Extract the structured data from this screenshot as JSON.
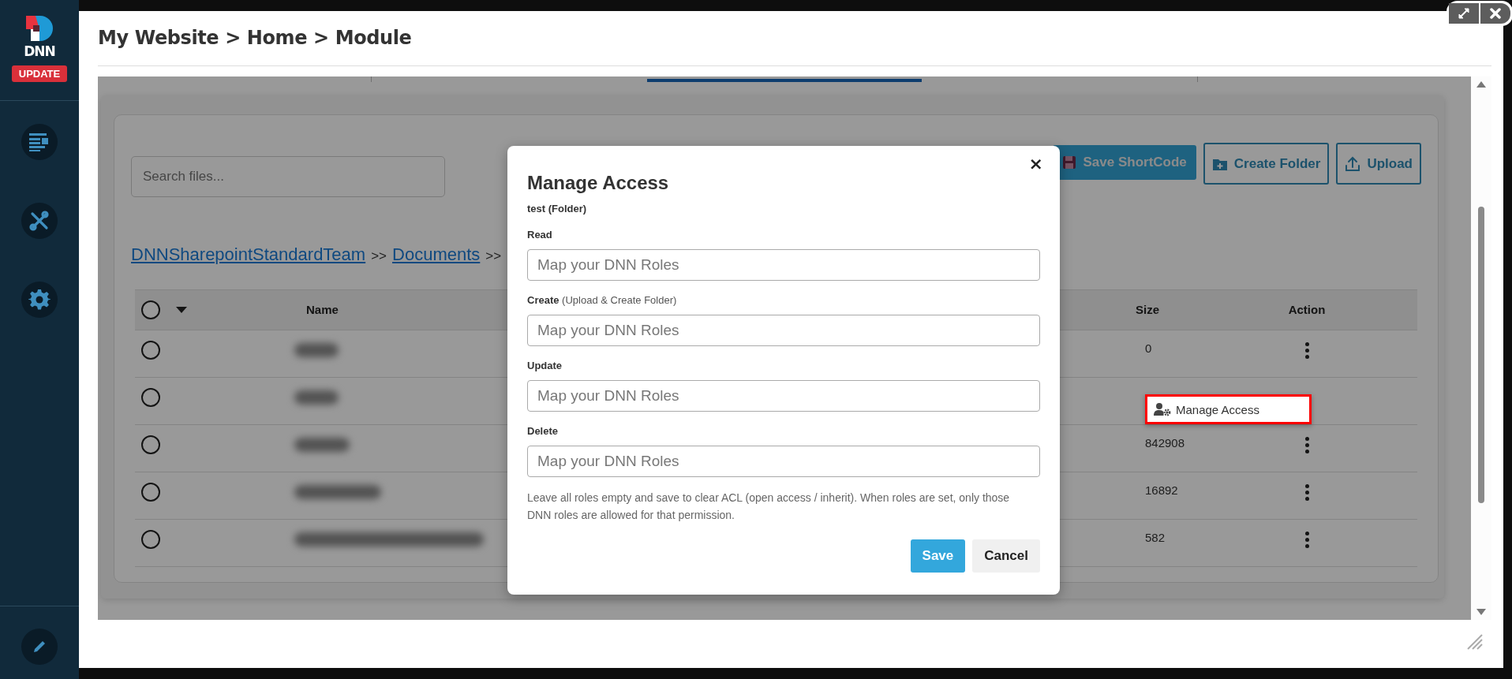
{
  "sidebar": {
    "logo_text": "DNN",
    "update_badge": "UPDATE",
    "nav": [
      {
        "kind": "pages"
      },
      {
        "kind": "tools"
      },
      {
        "kind": "settings"
      }
    ],
    "footer": [
      {
        "kind": "edit"
      }
    ]
  },
  "window": {
    "title": "My Website > Home > Module"
  },
  "window_controls": [
    {
      "kind": "maximize"
    },
    {
      "kind": "close"
    }
  ],
  "module": {
    "search": {
      "placeholder": "Search files..."
    },
    "buttons": [
      {
        "label": "Save ShortCode",
        "kind": "save"
      },
      {
        "label": "Create Folder",
        "kind": "folder"
      },
      {
        "label": "Upload",
        "kind": "upload"
      }
    ],
    "path": [
      {
        "label": "DNNSharepointStandardTeam",
        "kind": "link"
      },
      {
        "label": ">>",
        "kind": "separator"
      },
      {
        "label": "Documents",
        "kind": "link"
      },
      {
        "label": ">>",
        "kind": "separator"
      }
    ],
    "table": {
      "select_all": false,
      "columns": [
        {
          "label": "Name",
          "kind": "name"
        },
        {
          "label": "Size",
          "kind": "size"
        },
        {
          "label": "Action",
          "kind": "action"
        }
      ],
      "rows": [
        {
          "selected": false,
          "name_blurred": true,
          "size": "0",
          "menu_open": false
        },
        {
          "selected": false,
          "name_blurred": true,
          "menu_open": true
        },
        {
          "selected": false,
          "name_blurred": true,
          "size": "842908",
          "menu_open": false
        },
        {
          "selected": false,
          "name_blurred": true,
          "size": "16892",
          "menu_open": false
        },
        {
          "selected": false,
          "name_blurred": true,
          "size": "582",
          "menu_open": false
        }
      ]
    },
    "context_menu": {
      "items": [
        {
          "label": "Manage Access",
          "kind": "user-gear",
          "highlighted": true
        }
      ]
    }
  },
  "modal": {
    "title": "Manage Access",
    "subtitle": "test (Folder)",
    "close": "×",
    "fields": [
      {
        "label": "Read",
        "placeholder": "Map your DNN Roles"
      },
      {
        "label": "Create",
        "note": "(Upload & Create Folder)",
        "placeholder": "Map your DNN Roles"
      },
      {
        "label": "Update",
        "placeholder": "Map your DNN Roles"
      },
      {
        "label": "Delete",
        "placeholder": "Map your DNN Roles"
      }
    ],
    "help": "Leave all roles empty and save to clear ACL (open access / inherit). When roles are set, only those DNN roles are allowed for that permission.",
    "buttons": [
      {
        "label": "Save",
        "kind": "primary"
      },
      {
        "label": "Cancel",
        "kind": "secondary"
      }
    ]
  }
}
